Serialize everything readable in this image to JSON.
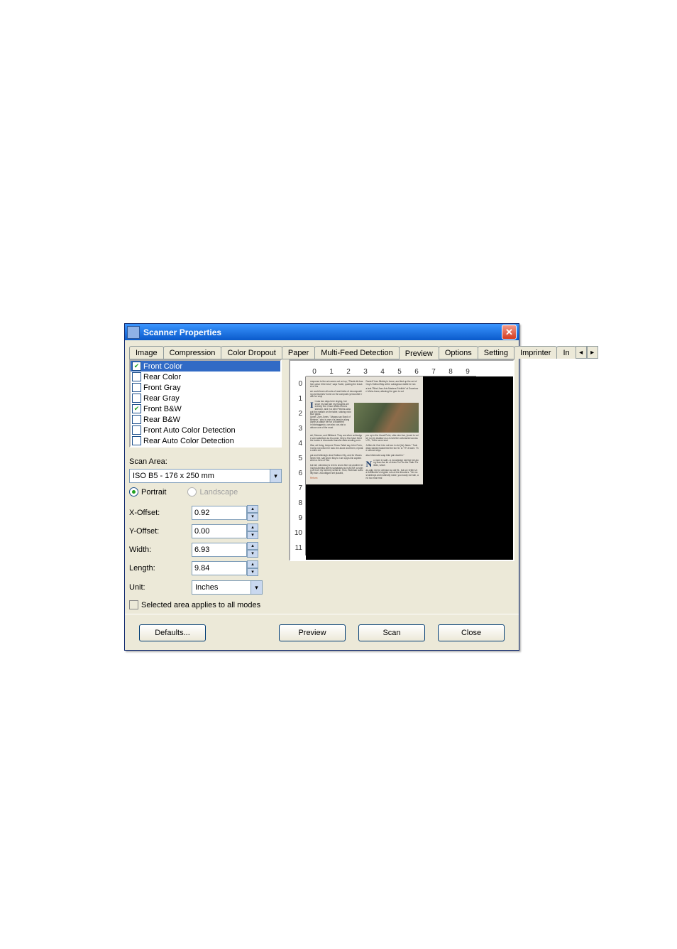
{
  "window": {
    "title": "Scanner Properties"
  },
  "tabs": {
    "items": [
      {
        "label": "Image"
      },
      {
        "label": "Compression"
      },
      {
        "label": "Color Dropout"
      },
      {
        "label": "Paper"
      },
      {
        "label": "Multi-Feed Detection"
      },
      {
        "label": "Preview"
      },
      {
        "label": "Options"
      },
      {
        "label": "Setting"
      },
      {
        "label": "Imprinter"
      },
      {
        "label": "In"
      }
    ],
    "active_index": 5
  },
  "image_selection": {
    "items": [
      {
        "label": "Front Color",
        "checked": true,
        "selected": true
      },
      {
        "label": "Rear Color",
        "checked": false,
        "selected": false
      },
      {
        "label": "Front Gray",
        "checked": false,
        "selected": false
      },
      {
        "label": "Rear Gray",
        "checked": false,
        "selected": false
      },
      {
        "label": "Front B&W",
        "checked": true,
        "selected": false
      },
      {
        "label": "Rear B&W",
        "checked": false,
        "selected": false
      },
      {
        "label": "Front Auto Color Detection",
        "checked": false,
        "selected": false
      },
      {
        "label": "Rear Auto Color Detection",
        "checked": false,
        "selected": false
      }
    ]
  },
  "scan_area": {
    "label": "Scan Area:",
    "preset": "ISO B5 - 176 x 250 mm",
    "orientation": {
      "portrait_label": "Portrait",
      "landscape_label": "Landscape",
      "value": "portrait",
      "landscape_enabled": false
    },
    "x_offset": {
      "label": "X-Offset:",
      "value": "0.92"
    },
    "y_offset": {
      "label": "Y-Offset:",
      "value": "0.00"
    },
    "width": {
      "label": "Width:",
      "value": "6.93"
    },
    "length": {
      "label": "Length:",
      "value": "9.84"
    },
    "unit": {
      "label": "Unit:",
      "value": "Inches"
    },
    "all_modes": {
      "label": "Selected area applies to all modes",
      "checked": false
    }
  },
  "ruler": {
    "h_ticks": [
      "0",
      "1",
      "2",
      "3",
      "4",
      "5",
      "6",
      "7",
      "8",
      "9"
    ],
    "v_ticks": [
      "0",
      "1",
      "2",
      "3",
      "4",
      "5",
      "6",
      "7",
      "8",
      "9",
      "10",
      "11"
    ]
  },
  "buttons": {
    "defaults": "Defaults...",
    "preview": "Preview",
    "scan": "Scan",
    "close": "Close"
  }
}
